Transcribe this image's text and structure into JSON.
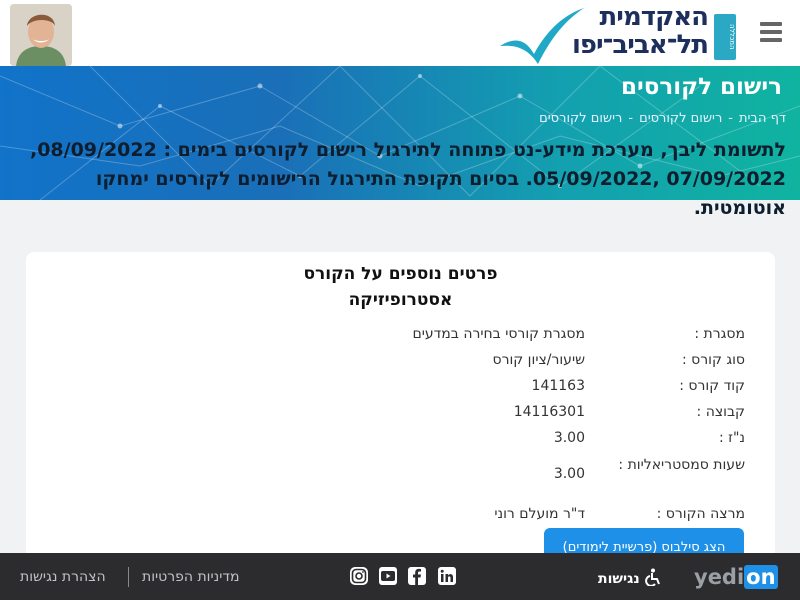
{
  "header": {
    "logo_line1": "האקדמית",
    "logo_line2": "תל־אביב־יפו",
    "logo_vertical": "המכללה",
    "menu_icon": "hamburger-menu-icon",
    "avatar_icon": "user-avatar"
  },
  "banner": {
    "title": "רישום לקורסים",
    "breadcrumb": [
      "דף הבית",
      "רישום לקורסים",
      "רישום לקורסים"
    ],
    "breadcrumb_sep": "-",
    "notice": "לתשומת ליבך, מערכת מידע-נט פתוחה לתירגול רישום לקורסים בימים : 08/09/2022, 07/09/2022 ,05/09/2022. בסיום תקופת התירגול הרישומים לקורסים ימחקו אוטומטית."
  },
  "card": {
    "title": "פרטים נוספים על הקורס",
    "course_name": "אסטרופיזיקה",
    "rows": [
      {
        "label": "מסגרת :",
        "value": "מסגרת קורסי בחירה במדעים"
      },
      {
        "label": "סוג קורס :",
        "value": "שיעור/ציון קורס"
      },
      {
        "label": "קוד קורס :",
        "value": "141163"
      },
      {
        "label": "קבוצה :",
        "value": "14116301"
      },
      {
        "label": "נ\"ז :",
        "value": "3.00"
      },
      {
        "label": "שעות סמסטריאליות :",
        "value": "3.00"
      },
      {
        "label": "מרצה הקורס :",
        "value": "ד\"ר מועלם רוני"
      }
    ],
    "syllabus_button": "הצג סילבוס (פרשיית לימודים)"
  },
  "footer": {
    "brand_prefix": "yedi",
    "brand_suffix": "on",
    "accessibility": "נגישות",
    "privacy": "מדיניות הפרטיות",
    "accessibility_statement": "הצהרת נגישות",
    "social": [
      "linkedin-icon",
      "facebook-icon",
      "youtube-icon",
      "instagram-icon"
    ]
  },
  "colors": {
    "banner_start": "#1173c9",
    "banner_end": "#10b3a0",
    "button": "#1e90e8",
    "footer": "#2c2c2e",
    "brand_navy": "#1d2f5c"
  }
}
